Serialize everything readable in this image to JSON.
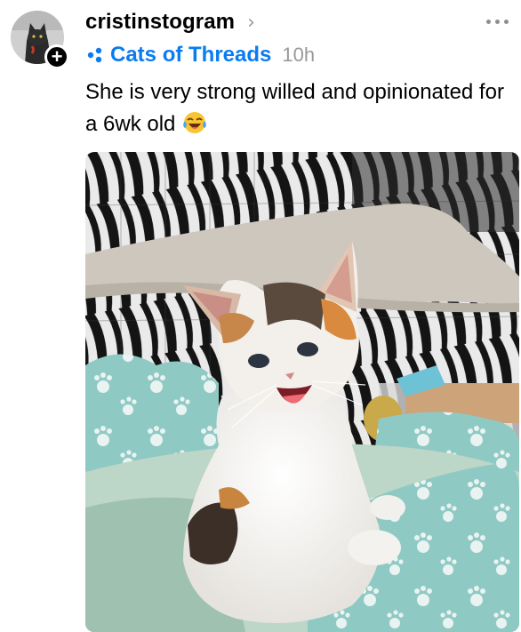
{
  "post": {
    "username": "cristinstogram",
    "community": "Cats of Threads",
    "time": "10h",
    "text": "She is very strong willed and opinionated for a 6wk old",
    "emoji": "😂"
  },
  "icons": {
    "avatar": "cat-avatar",
    "follow": "plus-icon",
    "chevron": "chevron-right-icon",
    "more": "more-options-icon",
    "community": "community-icon",
    "emoji": "face-with-tears-of-joy-icon"
  },
  "colors": {
    "community_accent": "#0a7cf0",
    "muted": "#999999"
  }
}
